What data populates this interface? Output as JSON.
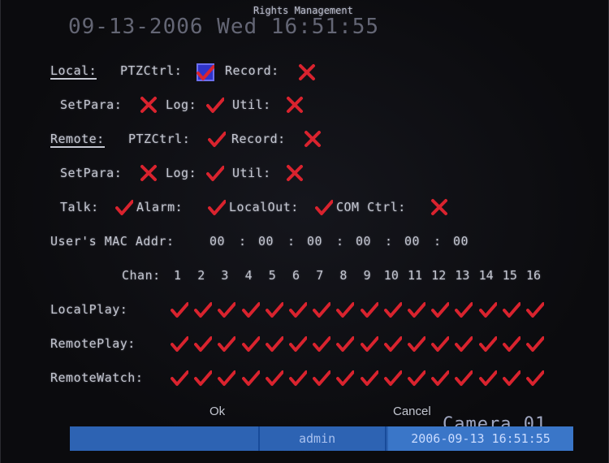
{
  "header": {
    "watermark_datetime": "09-13-2006 Wed 16:51:55",
    "title_overlay": "Rights Management"
  },
  "local": {
    "label": "Local:",
    "row1": [
      {
        "label": "PTZCtrl:",
        "state": "check",
        "focused": true
      },
      {
        "label": "Record:",
        "state": "cross"
      }
    ],
    "row2": [
      {
        "label": "SetPara:",
        "state": "cross"
      },
      {
        "label": "Log:",
        "state": "check"
      },
      {
        "label": "Util:",
        "state": "cross"
      }
    ]
  },
  "remote": {
    "label": "Remote:",
    "row1": [
      {
        "label": "PTZCtrl:",
        "state": "check"
      },
      {
        "label": "Record:",
        "state": "cross"
      }
    ],
    "row2": [
      {
        "label": "SetPara:",
        "state": "cross"
      },
      {
        "label": "Log:",
        "state": "check"
      },
      {
        "label": "Util:",
        "state": "cross"
      }
    ],
    "row3": [
      {
        "label": "Talk:",
        "state": "check"
      },
      {
        "label": "Alarm:",
        "state": "check"
      },
      {
        "label": "LocalOut:",
        "state": "check"
      },
      {
        "label": "COM Ctrl:",
        "state": "cross"
      }
    ]
  },
  "mac": {
    "label": "User's MAC Addr:",
    "octets": [
      "00",
      "00",
      "00",
      "00",
      "00",
      "00"
    ],
    "separator": ":"
  },
  "channels": {
    "label": "Chan:",
    "numbers": [
      "1",
      "2",
      "3",
      "4",
      "5",
      "6",
      "7",
      "8",
      "9",
      "10",
      "11",
      "12",
      "13",
      "14",
      "15",
      "16"
    ],
    "rows": [
      {
        "label": "LocalPlay:",
        "states": [
          "check",
          "check",
          "check",
          "check",
          "check",
          "check",
          "check",
          "check",
          "check",
          "check",
          "check",
          "check",
          "check",
          "check",
          "check",
          "check"
        ]
      },
      {
        "label": "RemotePlay:",
        "states": [
          "check",
          "check",
          "check",
          "check",
          "check",
          "check",
          "check",
          "check",
          "check",
          "check",
          "check",
          "check",
          "check",
          "check",
          "check",
          "check"
        ]
      },
      {
        "label": "RemoteWatch:",
        "states": [
          "check",
          "check",
          "check",
          "check",
          "check",
          "check",
          "check",
          "check",
          "check",
          "check",
          "check",
          "check",
          "check",
          "check",
          "check",
          "check"
        ]
      }
    ]
  },
  "buttons": {
    "ok": "Ok",
    "cancel": "Cancel"
  },
  "statusbar": {
    "user": "admin",
    "datetime": "2006-09-13 16:51:55"
  },
  "camera_label": "Camera 01",
  "colors": {
    "mark": "#d9232e",
    "focus": "#2f33c9",
    "statusbar": "#2d63b3",
    "text": "#c3c6d0",
    "background": "#0b0b0e"
  }
}
